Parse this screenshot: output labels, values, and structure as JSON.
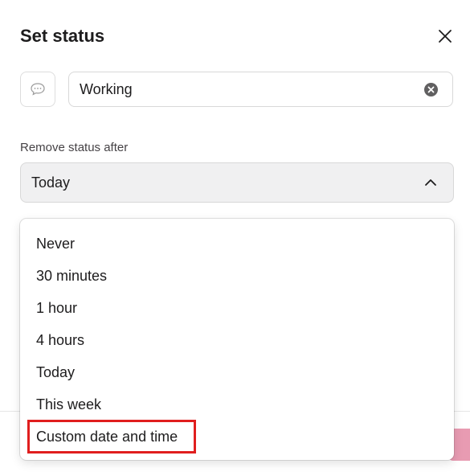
{
  "dialog": {
    "title": "Set status"
  },
  "status": {
    "emoji_icon": "speech-bubble-icon",
    "value": "Working"
  },
  "expiration": {
    "label": "Remove status after",
    "selected": "Today",
    "options": [
      "Never",
      "30 minutes",
      "1 hour",
      "4 hours",
      "Today",
      "This week",
      "Custom date and time"
    ],
    "highlighted_option": "Custom date and time"
  },
  "colors": {
    "highlight_border": "#e01e1e",
    "select_background": "#f0f0f1",
    "save_button_accent": "#e89bb2"
  }
}
